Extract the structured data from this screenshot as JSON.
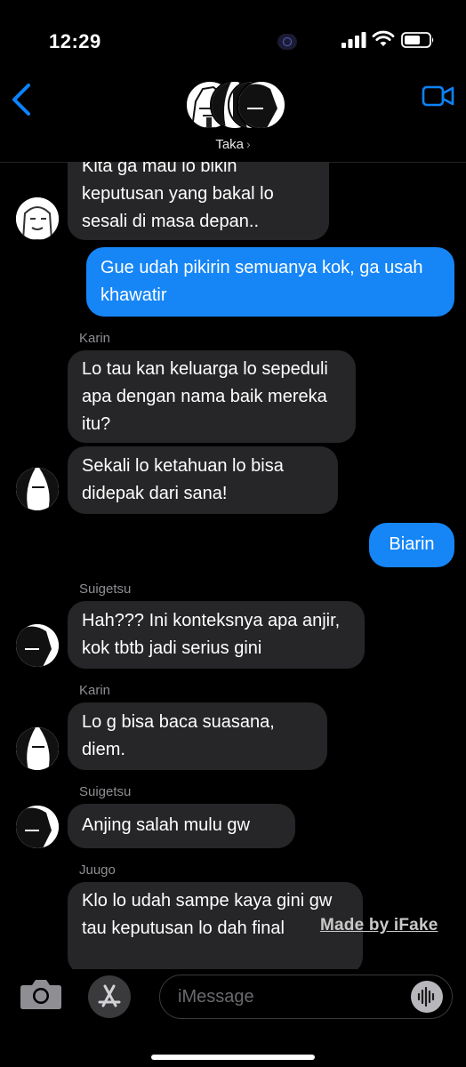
{
  "status_bar": {
    "time": "12:29"
  },
  "header": {
    "contact_name": "Taka"
  },
  "messages": [
    {
      "type": "in",
      "text": "Kita ga mau lo bikin keputusan yang bakal lo sesali di masa depan.."
    },
    {
      "type": "out",
      "text": "Gue udah pikirin semuanya kok, ga usah khawatir"
    },
    {
      "type": "sender",
      "text": "Karin"
    },
    {
      "type": "in",
      "text": "Lo tau kan keluarga lo sepeduli apa dengan nama baik mereka itu?"
    },
    {
      "type": "in",
      "text": "Sekali lo ketahuan lo bisa didepak dari sana!"
    },
    {
      "type": "out",
      "text": "Biarin"
    },
    {
      "type": "sender",
      "text": "Suigetsu"
    },
    {
      "type": "in",
      "text": "Hah??? Ini konteksnya apa anjir, kok tbtb jadi serius gini"
    },
    {
      "type": "sender",
      "text": "Karin"
    },
    {
      "type": "in",
      "text": "Lo g bisa baca suasana, diem."
    },
    {
      "type": "sender",
      "text": "Suigetsu"
    },
    {
      "type": "in",
      "text": "Anjing salah mulu gw"
    },
    {
      "type": "sender",
      "text": "Juugo"
    },
    {
      "type": "in",
      "text": "Klo lo udah sampe kaya gini gw tau keputusan lo dah final"
    }
  ],
  "watermark": "Made by iFake",
  "input": {
    "placeholder": "iMessage"
  },
  "colors": {
    "outgoing": "#1686f7",
    "incoming": "#262628",
    "accent": "#0a84ff"
  }
}
